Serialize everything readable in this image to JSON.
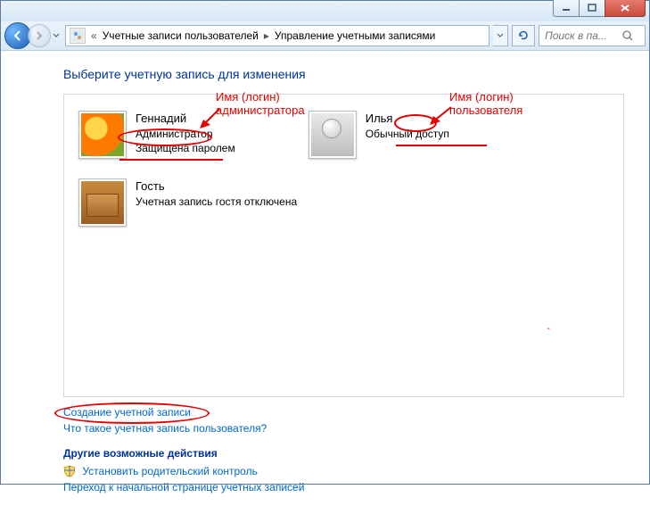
{
  "breadcrumb": {
    "item1": "Учетные записи пользователей",
    "item2": "Управление учетными записями"
  },
  "search": {
    "placeholder": "Поиск в па..."
  },
  "page_title": "Выберите учетную запись для изменения",
  "accounts": {
    "a0": {
      "name": "Геннадий",
      "role": "Администратор",
      "status": "Защищена паролем"
    },
    "a1": {
      "name": "Илья",
      "role": "Обычный доступ"
    },
    "a2": {
      "name": "Гость",
      "role": "Учетная запись гостя отключена"
    }
  },
  "annotations": {
    "admin_label_l1": "Имя (логин)",
    "admin_label_l2": "администратора",
    "user_label_l1": "Имя (логин)",
    "user_label_l2": "пользователя"
  },
  "links": {
    "create": "Создание учетной записи",
    "what_is": "Что такое учетная запись пользователя?",
    "other_title": "Другие возможные действия",
    "parental": "Установить родительский контроль",
    "goto_start": "Переход к начальной странице учетных записей"
  }
}
